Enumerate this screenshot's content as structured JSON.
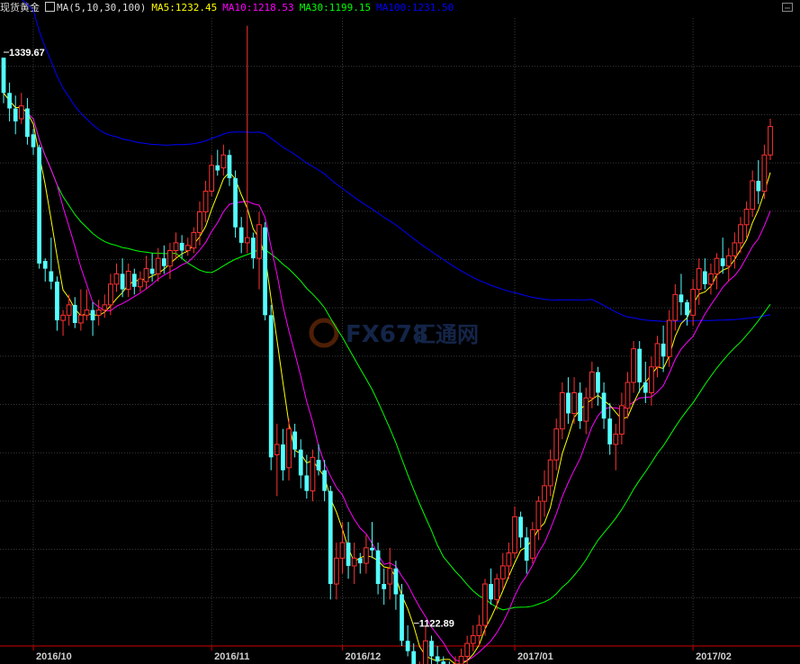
{
  "header": {
    "instrument": "现货黄金",
    "ma_params": "MA(5,10,30,100)",
    "ma_values": [
      {
        "label": "MA5:1232.45",
        "color": "#ffff00"
      },
      {
        "label": "MA10:1218.53",
        "color": "#ff00ff"
      },
      {
        "label": "MA30:1199.15",
        "color": "#00ff00"
      },
      {
        "label": "MA100:1231.50",
        "color": "#0000ff"
      }
    ]
  },
  "watermark": {
    "brand": "FX678",
    "cn": "汇通网"
  },
  "chart_data": {
    "type": "candlestick",
    "ylim": [
      1112,
      1355
    ],
    "x_tick_labels": [
      {
        "label": "2016/10",
        "index": 5
      },
      {
        "label": "2016/11",
        "index": 35
      },
      {
        "label": "2016/12",
        "index": 57
      },
      {
        "label": "2017/01",
        "index": 86
      },
      {
        "label": "2017/02",
        "index": 116
      }
    ],
    "annotations": [
      {
        "label": "1339.67",
        "index": 0,
        "value": 1339.67,
        "side": "top"
      },
      {
        "label": "1122.89",
        "index": 69,
        "value": 1122.89,
        "side": "bottom"
      }
    ],
    "candles": [
      [
        1339.67,
        1339.67,
        1322,
        1326
      ],
      [
        1326,
        1330,
        1315,
        1320
      ],
      [
        1320,
        1325,
        1310,
        1315
      ],
      [
        1316,
        1326,
        1314,
        1321
      ],
      [
        1320,
        1324,
        1306,
        1309
      ],
      [
        1310,
        1312,
        1302,
        1305
      ],
      [
        1305,
        1306,
        1258,
        1260
      ],
      [
        1261,
        1262,
        1253,
        1258
      ],
      [
        1257,
        1270,
        1250,
        1253
      ],
      [
        1253,
        1255,
        1234,
        1238
      ],
      [
        1238,
        1242,
        1232,
        1240
      ],
      [
        1240,
        1248,
        1236,
        1244
      ],
      [
        1244,
        1247,
        1235,
        1237
      ],
      [
        1237,
        1250,
        1234,
        1240
      ],
      [
        1240,
        1250,
        1238,
        1242
      ],
      [
        1242,
        1245,
        1232,
        1238
      ],
      [
        1240,
        1246,
        1236,
        1242
      ],
      [
        1242,
        1248,
        1239,
        1244
      ],
      [
        1244,
        1256,
        1240,
        1252
      ],
      [
        1252,
        1260,
        1249,
        1256
      ],
      [
        1256,
        1262,
        1247,
        1250
      ],
      [
        1250,
        1260,
        1247,
        1257
      ],
      [
        1256,
        1258,
        1248,
        1251
      ],
      [
        1251,
        1257,
        1249,
        1254
      ],
      [
        1253,
        1263,
        1250,
        1258
      ],
      [
        1258,
        1264,
        1253,
        1256
      ],
      [
        1256,
        1266,
        1253,
        1262
      ],
      [
        1262,
        1267,
        1256,
        1259
      ],
      [
        1259,
        1268,
        1254,
        1265
      ],
      [
        1265,
        1272,
        1262,
        1268
      ],
      [
        1268,
        1271,
        1262,
        1265
      ],
      [
        1265,
        1270,
        1263,
        1267
      ],
      [
        1266,
        1274,
        1264,
        1272
      ],
      [
        1272,
        1284,
        1267,
        1280
      ],
      [
        1280,
        1292,
        1276,
        1288
      ],
      [
        1288,
        1302,
        1286,
        1298
      ],
      [
        1298,
        1304,
        1294,
        1296
      ],
      [
        1297,
        1306,
        1294,
        1302
      ],
      [
        1302,
        1304,
        1290,
        1293
      ],
      [
        1293,
        1296,
        1270,
        1274
      ],
      [
        1274,
        1278,
        1264,
        1268
      ],
      [
        1268,
        1352,
        1264,
        1270
      ],
      [
        1270,
        1272,
        1258,
        1262
      ],
      [
        1262,
        1280,
        1250,
        1275
      ],
      [
        1274,
        1276,
        1238,
        1240
      ],
      [
        1240,
        1244,
        1180,
        1185
      ],
      [
        1186,
        1198,
        1170,
        1190
      ],
      [
        1190,
        1196,
        1176,
        1180
      ],
      [
        1181,
        1200,
        1176,
        1196
      ],
      [
        1195,
        1198,
        1185,
        1188
      ],
      [
        1188,
        1192,
        1173,
        1178
      ],
      [
        1178,
        1186,
        1169,
        1172
      ],
      [
        1172,
        1188,
        1168,
        1185
      ],
      [
        1184,
        1190,
        1178,
        1180
      ],
      [
        1180,
        1184,
        1168,
        1172
      ],
      [
        1172,
        1174,
        1130,
        1136
      ],
      [
        1136,
        1152,
        1130,
        1146
      ],
      [
        1146,
        1160,
        1140,
        1152
      ],
      [
        1152,
        1160,
        1138,
        1143
      ],
      [
        1143,
        1152,
        1136,
        1146
      ],
      [
        1146,
        1148,
        1140,
        1144
      ],
      [
        1144,
        1155,
        1140,
        1150
      ],
      [
        1150,
        1160,
        1146,
        1149
      ],
      [
        1149,
        1152,
        1132,
        1136
      ],
      [
        1136,
        1142,
        1128,
        1134
      ],
      [
        1136,
        1150,
        1130,
        1142
      ],
      [
        1142,
        1145,
        1126,
        1132
      ],
      [
        1132,
        1136,
        1112,
        1114
      ],
      [
        1114,
        1120,
        1108,
        1110
      ],
      [
        1110,
        1113,
        1099,
        1101
      ],
      [
        1101,
        1106,
        1098,
        1102
      ],
      [
        1102,
        1120,
        1100,
        1114
      ],
      [
        1114,
        1116,
        1104,
        1108
      ],
      [
        1108,
        1112,
        1102,
        1106
      ],
      [
        1106,
        1108,
        1100,
        1104
      ],
      [
        1104,
        1106,
        1098,
        1102
      ],
      [
        1102,
        1108,
        1099,
        1105
      ],
      [
        1105,
        1111,
        1102,
        1108
      ],
      [
        1108,
        1116,
        1104,
        1113
      ],
      [
        1113,
        1120,
        1110,
        1116
      ],
      [
        1116,
        1124,
        1112,
        1120
      ],
      [
        1120,
        1138,
        1116,
        1136
      ],
      [
        1136,
        1142,
        1128,
        1130
      ],
      [
        1130,
        1140,
        1126,
        1138
      ],
      [
        1138,
        1148,
        1134,
        1143
      ],
      [
        1143,
        1152,
        1138,
        1148
      ],
      [
        1148,
        1166,
        1146,
        1162
      ],
      [
        1162,
        1164,
        1150,
        1154
      ],
      [
        1154,
        1158,
        1140,
        1145
      ],
      [
        1146,
        1160,
        1144,
        1157
      ],
      [
        1157,
        1170,
        1153,
        1168
      ],
      [
        1168,
        1180,
        1162,
        1174
      ],
      [
        1174,
        1188,
        1170,
        1184
      ],
      [
        1184,
        1200,
        1180,
        1196
      ],
      [
        1196,
        1214,
        1192,
        1210
      ],
      [
        1210,
        1216,
        1198,
        1202
      ],
      [
        1202,
        1216,
        1198,
        1210
      ],
      [
        1210,
        1214,
        1196,
        1199
      ],
      [
        1199,
        1212,
        1194,
        1208
      ],
      [
        1208,
        1222,
        1204,
        1218
      ],
      [
        1218,
        1220,
        1205,
        1210
      ],
      [
        1210,
        1214,
        1196,
        1200
      ],
      [
        1200,
        1206,
        1186,
        1190
      ],
      [
        1190,
        1198,
        1180,
        1194
      ],
      [
        1194,
        1210,
        1190,
        1205
      ],
      [
        1204,
        1218,
        1200,
        1214
      ],
      [
        1214,
        1230,
        1210,
        1227
      ],
      [
        1227,
        1230,
        1210,
        1214
      ],
      [
        1214,
        1222,
        1206,
        1210
      ],
      [
        1210,
        1224,
        1205,
        1220
      ],
      [
        1220,
        1232,
        1216,
        1229
      ],
      [
        1229,
        1236,
        1218,
        1224
      ],
      [
        1224,
        1242,
        1220,
        1238
      ],
      [
        1238,
        1252,
        1234,
        1248
      ],
      [
        1248,
        1256,
        1240,
        1245
      ],
      [
        1245,
        1246,
        1236,
        1240
      ],
      [
        1240,
        1254,
        1236,
        1250
      ],
      [
        1250,
        1262,
        1244,
        1258
      ],
      [
        1257,
        1262,
        1250,
        1252
      ],
      [
        1252,
        1260,
        1248,
        1256
      ],
      [
        1256,
        1264,
        1250,
        1262
      ],
      [
        1262,
        1270,
        1256,
        1259
      ],
      [
        1259,
        1266,
        1253,
        1263
      ],
      [
        1263,
        1272,
        1258,
        1268
      ],
      [
        1268,
        1278,
        1264,
        1275
      ],
      [
        1275,
        1284,
        1270,
        1281
      ],
      [
        1281,
        1296,
        1278,
        1292
      ],
      [
        1292,
        1300,
        1283,
        1288
      ],
      [
        1288,
        1306,
        1285,
        1302
      ],
      [
        1302,
        1316,
        1300,
        1313
      ]
    ]
  }
}
